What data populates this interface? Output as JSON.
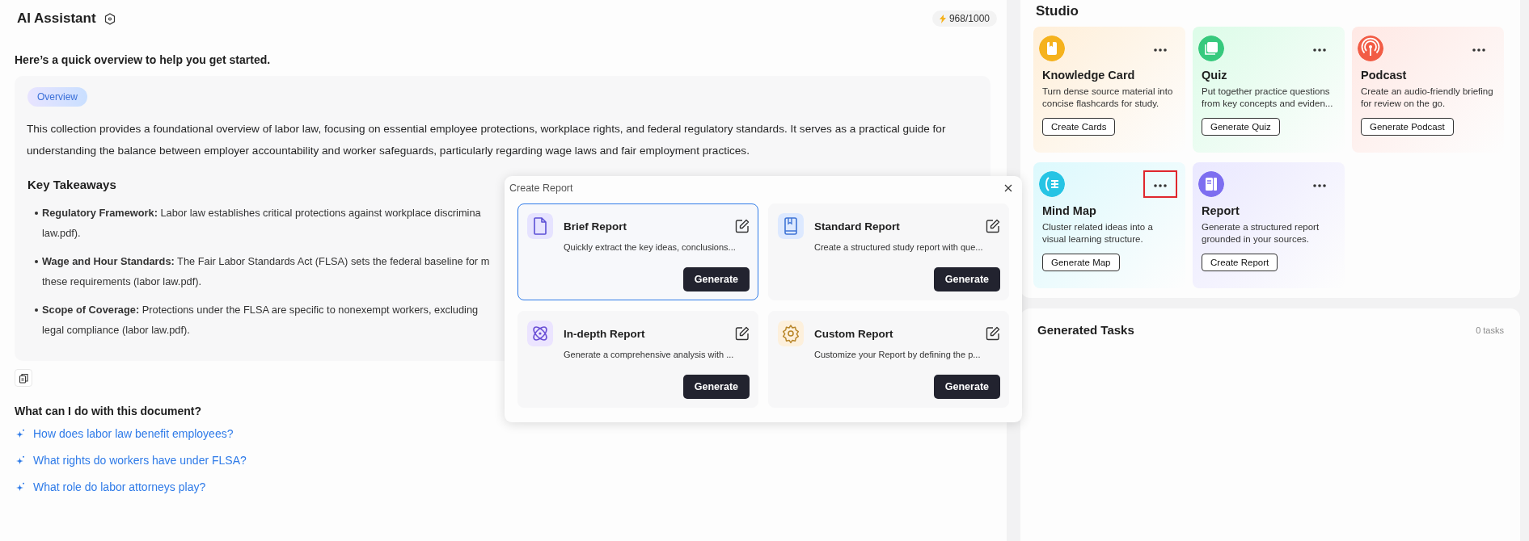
{
  "assistant": {
    "title": "AI Assistant",
    "credits": "968/1000",
    "intro": "Here’s a quick overview to help you get started.",
    "overview": {
      "tag": "Overview",
      "summary": "This collection provides a foundational overview of labor law, focusing on essential employee protections, workplace rights, and federal regulatory standards. It serves as a practical guide for understanding the balance between employer accountability and worker safeguards, particularly regarding wage laws and fair employment practices.",
      "takeaways_title": "Key Takeaways",
      "takeaways": [
        {
          "lines": [
            "**Regulatory Framework:** Labor law establishes critical protections against workplace discrimina",
            "law.pdf)."
          ]
        },
        {
          "lines": [
            "**Wage and Hour Standards:** The Fair Labor Standards Act (FLSA) sets the federal baseline for m",
            "these requirements (labor law.pdf)."
          ]
        },
        {
          "lines": [
            "**Scope of Coverage:** Protections under the FLSA are specific to nonexempt workers, excluding",
            "legal compliance (labor law.pdf)."
          ]
        }
      ]
    },
    "questions_title": "What can I do with this document?",
    "questions": [
      "How does labor law benefit employees?",
      "What rights do workers have under FLSA?",
      "What role do labor attorneys play?"
    ]
  },
  "create_report": {
    "title": "Create Report",
    "options": [
      {
        "title": "Brief Report",
        "description": "Quickly extract the key ideas, conclusions...",
        "button": "Generate",
        "selected": true
      },
      {
        "title": "Standard Report",
        "description": "Create a structured study report with que...",
        "button": "Generate",
        "selected": false
      },
      {
        "title": "In-depth Report",
        "description": "Generate a comprehensive analysis with ...",
        "button": "Generate",
        "selected": false
      },
      {
        "title": "Custom Report",
        "description": "Customize your Report by defining the p...",
        "button": "Generate",
        "selected": false
      }
    ]
  },
  "studio": {
    "title": "Studio",
    "cards": [
      {
        "title": "Knowledge Card",
        "description": "Turn dense source material into concise flashcards for study.",
        "button": "Create Cards",
        "color": "#f5b21d",
        "highlighted": false
      },
      {
        "title": "Quiz",
        "description": "Put together practice questions from key concepts and eviden...",
        "button": "Generate Quiz",
        "color": "#37c97d",
        "highlighted": false
      },
      {
        "title": "Podcast",
        "description": "Create an audio-friendly briefing for review on the go.",
        "button": "Generate Podcast",
        "color": "#f25c45",
        "highlighted": false
      },
      {
        "title": "Mind Map",
        "description": "Cluster related ideas into a visual learning structure.",
        "button": "Generate Map",
        "color": "#26c4e4",
        "highlighted": true
      },
      {
        "title": "Report",
        "description": "Generate a structured report grounded in your sources.",
        "button": "Create Report",
        "color": "#7d6ef0",
        "highlighted": false
      }
    ]
  },
  "tasks": {
    "title": "Generated Tasks",
    "count": "0 tasks"
  }
}
